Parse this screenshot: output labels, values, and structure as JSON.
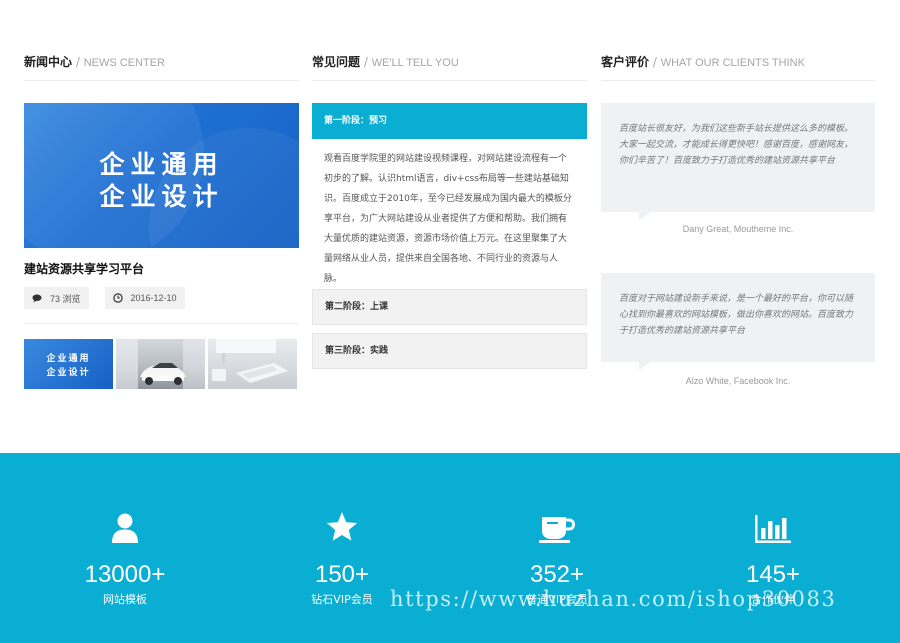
{
  "news": {
    "title_cn": "新闻中心",
    "separator": " / ",
    "title_en": "NEWS CENTER",
    "hero_line1": "企业通用",
    "hero_line2": "企业设计",
    "article_title": "建站资源共享学习平台",
    "views": "73 浏览",
    "date": "2016-12-10",
    "thumb_line1": "企业通用",
    "thumb_line2": "企业设计"
  },
  "faq": {
    "title_cn": "常见问题",
    "separator": " / ",
    "title_en": "WE'LL TELL YOU",
    "items": [
      {
        "label": "第一阶段：预习",
        "body": "观看百度学院里的网站建设视频课程，对网站建设流程有一个初步的了解。认识html语言，div+css布局等一些建站基础知识。百度成立于2010年，至今已经发展成为国内最大的模板分享平台，为广大网站建设从业者提供了方便和帮助。我们拥有大量优质的建站资源，资源市场价值上万元。在这里聚集了大量网络从业人员，提供来自全国各地、不同行业的资源与人脉。"
      },
      {
        "label": "第二阶段：上课"
      },
      {
        "label": "第三阶段：实践"
      }
    ]
  },
  "reviews": {
    "title_cn": "客户评价",
    "separator": " / ",
    "title_en": "WHAT OUR CLIENTS THINK",
    "items": [
      {
        "text": "百度站长很友好，为我们这些新手站长提供这么多的模板。大家一起交流，才能成长得更快吧！感谢百度，感谢网友，你们辛苦了！百度致力于打造优秀的建站资源共享平台",
        "author": "Dany Great, Moutheme Inc."
      },
      {
        "text": "百度对于网站建设新手来说，是一个最好的平台，你可以随心找到你最喜欢的网站模板，做出你喜欢的网站。百度致力于打造优秀的建站资源共享平台",
        "author": "Alzo White, Facebook Inc."
      }
    ]
  },
  "stats": [
    {
      "icon": "user-icon",
      "number": "13000+",
      "label": "网站模板"
    },
    {
      "icon": "star-icon",
      "number": "150+",
      "label": "钻石VIP会员"
    },
    {
      "icon": "coffee-cup-icon",
      "number": "352+",
      "label": "普通VIP会员"
    },
    {
      "icon": "bar-chart-icon",
      "number": "145+",
      "label": "合作伙伴"
    }
  ],
  "watermark": "https://www.huzhan.com/ishop30083",
  "colors": {
    "accent": "#0aaed3",
    "hero_blue": "#1f6fd2",
    "panel_gray": "#f0f1f3"
  }
}
